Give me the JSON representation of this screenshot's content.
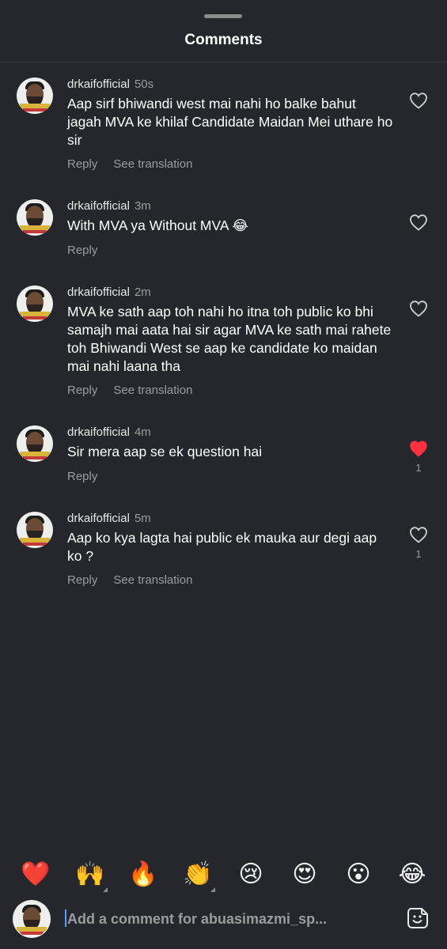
{
  "header": {
    "title": "Comments"
  },
  "comments": [
    {
      "username": "drkaifofficial",
      "time": "50s",
      "text": "Aap sirf bhiwandi west mai nahi ho balke bahut jagah MVA ke khilaf Candidate Maidan Mei uthare ho sir",
      "reply_label": "Reply",
      "translation_label": "See translation",
      "liked": false,
      "like_count": ""
    },
    {
      "username": "drkaifofficial",
      "time": "3m",
      "text": "With MVA ya Without MVA 😂",
      "reply_label": "Reply",
      "translation_label": "",
      "liked": false,
      "like_count": ""
    },
    {
      "username": "drkaifofficial",
      "time": "2m",
      "text": "MVA ke sath aap toh nahi ho itna toh public ko bhi samajh mai aata hai sir agar MVA ke sath mai rahete toh Bhiwandi West se aap ke candidate ko maidan mai nahi laana tha",
      "reply_label": "Reply",
      "translation_label": "See translation",
      "liked": false,
      "like_count": ""
    },
    {
      "username": "drkaifofficial",
      "time": "4m",
      "text": "Sir mera aap se ek question hai",
      "reply_label": "Reply",
      "translation_label": "",
      "liked": true,
      "like_count": "1"
    },
    {
      "username": "drkaifofficial",
      "time": "5m",
      "text": "Aap ko kya lagta hai public ek mauka aur degi aap ko ?",
      "reply_label": "Reply",
      "translation_label": "See translation",
      "liked": false,
      "like_count": "1"
    }
  ],
  "emoji_bar": [
    {
      "glyph": "❤️",
      "name": "red-heart-emoji"
    },
    {
      "glyph": "🙌",
      "name": "raising-hands-emoji"
    },
    {
      "glyph": "🔥",
      "name": "fire-emoji"
    },
    {
      "glyph": "👏",
      "name": "clapping-hands-emoji"
    },
    {
      "glyph": "😢",
      "name": "crying-face-emoji"
    },
    {
      "glyph": "😍",
      "name": "heart-eyes-emoji"
    },
    {
      "glyph": "😮",
      "name": "surprised-face-emoji"
    },
    {
      "glyph": "😂",
      "name": "tears-of-joy-emoji"
    }
  ],
  "composer": {
    "placeholder": "Add a comment for abuasimazmi_sp..."
  },
  "colors": {
    "background": "#25272c",
    "liked_heart": "#ff3040",
    "muted_text": "#9a9ca0"
  }
}
